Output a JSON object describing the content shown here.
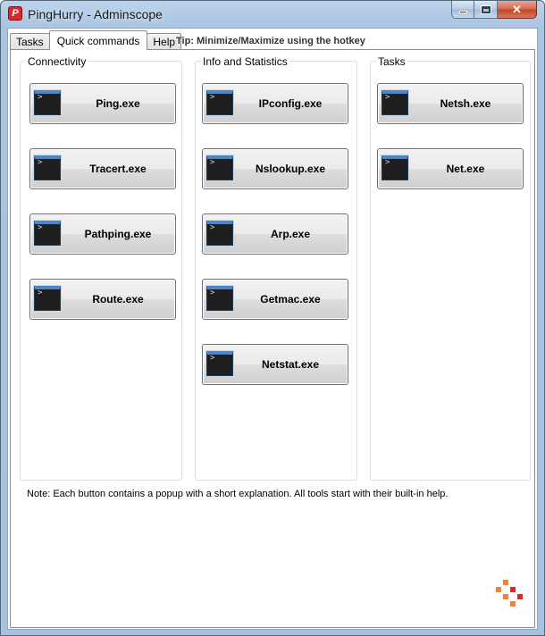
{
  "window": {
    "title": "PingHurry - Adminscope",
    "app_icon_letter": "P",
    "close_glyph": "✕"
  },
  "tabs": [
    {
      "label": "Tasks",
      "active": false
    },
    {
      "label": "Quick commands",
      "active": true
    },
    {
      "label": "Help",
      "active": false
    }
  ],
  "tip": "Tip: Minimize/Maximize using the hotkey",
  "groups": {
    "connectivity": {
      "title": "Connectivity",
      "buttons": [
        "Ping.exe",
        "Tracert.exe",
        "Pathping.exe",
        "Route.exe"
      ]
    },
    "info": {
      "title": "Info and Statistics",
      "buttons": [
        "IPconfig.exe",
        "Nslookup.exe",
        "Arp.exe",
        "Getmac.exe",
        "Netstat.exe"
      ]
    },
    "tasks": {
      "title": "Tasks",
      "buttons": [
        "Netsh.exe",
        "Net.exe"
      ]
    }
  },
  "note": "Note: Each button contains a popup with a short explanation. All tools start with their built-in help.",
  "colors": {
    "logo_orange": "#f0843c",
    "logo_red": "#d62b2b"
  },
  "icons": {
    "app": "app-logo-icon",
    "command": "console-window-icon",
    "brand": "adminscope-logo-icon"
  }
}
